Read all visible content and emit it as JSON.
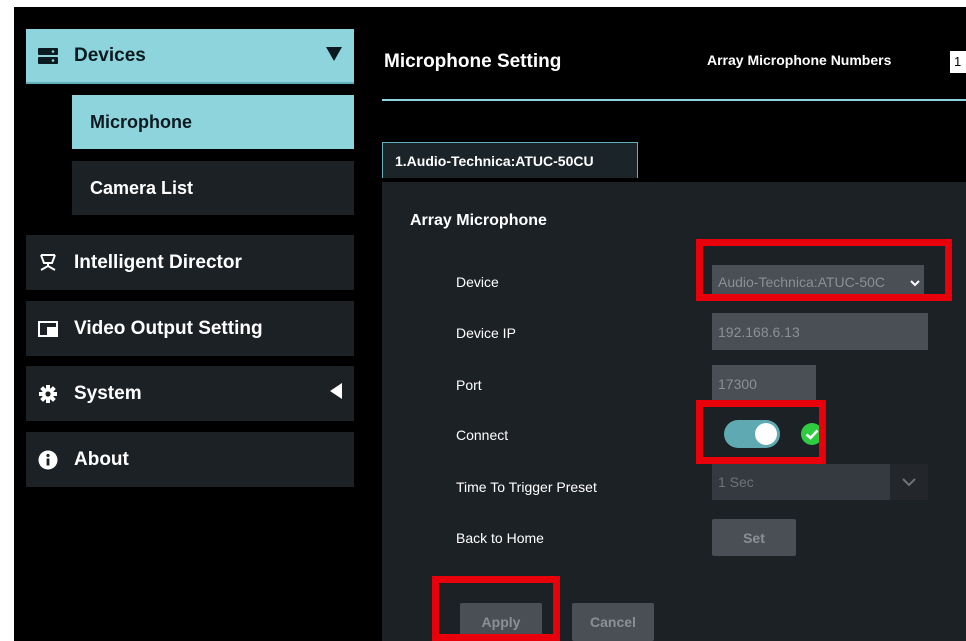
{
  "sidebar": {
    "devices": "Devices",
    "microphone": "Microphone",
    "camera_list": "Camera List",
    "intelligent_director": "Intelligent Director",
    "video_output": "Video Output Setting",
    "system": "System",
    "about": "About"
  },
  "header": {
    "title": "Microphone Setting",
    "array_label": "Array Microphone Numbers",
    "array_value": "1"
  },
  "tab": {
    "label": "1.Audio-Technica:ATUC-50CU"
  },
  "panel": {
    "title": "Array Microphone",
    "device_label": "Device",
    "device_value": "Audio-Technica:ATUC-50C",
    "ip_label": "Device IP",
    "ip_placeholder": "192.168.6.13",
    "port_label": "Port",
    "port_placeholder": "17300",
    "connect_label": "Connect",
    "connect_on": true,
    "trigger_label": "Time To Trigger Preset",
    "trigger_value": "1 Sec",
    "home_label": "Back to Home",
    "set_button": "Set",
    "apply_button": "Apply",
    "cancel_button": "Cancel"
  },
  "colors": {
    "accent": "#8ed4dc",
    "highlight": "#e8000b",
    "ok": "#2ecc40"
  }
}
